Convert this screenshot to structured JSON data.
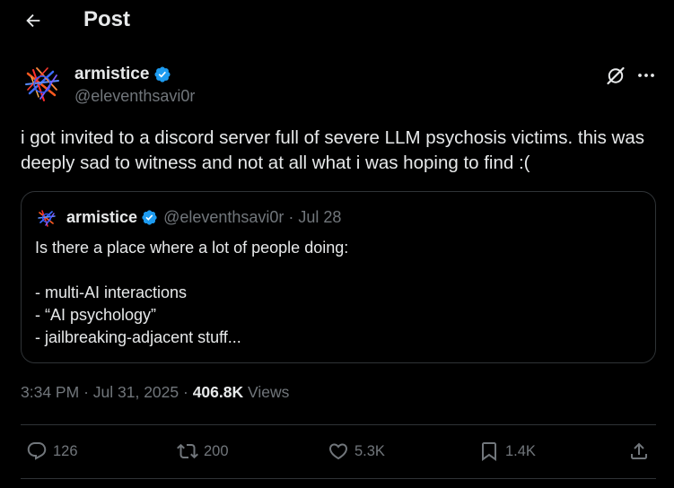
{
  "header": {
    "title": "Post",
    "back_icon": "arrow-left-icon"
  },
  "post": {
    "author": {
      "name": "armistice",
      "handle": "@eleventhsavi0r",
      "verified": true,
      "verified_color": "#1d9bf0"
    },
    "text": "i got invited to a discord server full of severe LLM psychosis victims. this was deeply sad to witness and not at all what i was hoping to find :(",
    "quoted": {
      "author": {
        "name": "armistice",
        "handle": "@eleventhsavi0r",
        "verified": true
      },
      "separator": "·",
      "date": "Jul 28",
      "lines": [
        "Is there a place where a lot of people doing:",
        "",
        "- multi-AI interactions",
        "- “AI psychology”",
        "- jailbreaking-adjacent stuff..."
      ]
    },
    "time": "3:34 PM",
    "date": "Jul 31, 2025",
    "separator": "·",
    "views": "406.8K",
    "views_label": "Views"
  },
  "actions": {
    "replies": "126",
    "reposts": "200",
    "likes": "5.3K",
    "bookmarks": "1.4K"
  },
  "colors": {
    "background": "#000000",
    "text_primary": "#e7e9ea",
    "text_secondary": "#71767b",
    "border": "#2f3336",
    "accent": "#1d9bf0"
  }
}
